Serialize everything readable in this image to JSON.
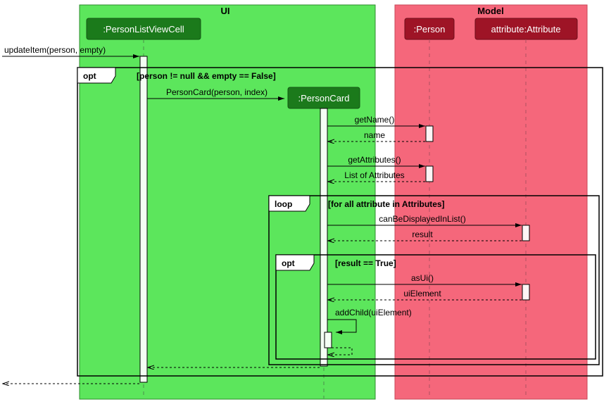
{
  "boxes": {
    "ui": {
      "label": "UI",
      "color": "#5CE65C"
    },
    "model": {
      "label": "Model",
      "color": "#F5677B"
    }
  },
  "participants": {
    "personListViewCell": ":PersonListViewCell",
    "personCard": ":PersonCard",
    "person": ":Person",
    "attribute": "attribute:Attribute"
  },
  "messages": {
    "updateItem": "updateItem(person, empty)",
    "personCardCtor": "PersonCard(person, index)",
    "getName": "getName()",
    "nameRet": "name",
    "getAttributes": "getAttributes()",
    "attributesRet": "List of Attributes",
    "canBeDisplayed": "canBeDisplayedInList()",
    "resultRet": "result",
    "asUi": "asUi()",
    "uiElementRet": "uiElement",
    "addChild": "addChild(uiElement)"
  },
  "fragments": {
    "opt1": {
      "type": "opt",
      "guard": "[person != null && empty == False]"
    },
    "loop": {
      "type": "loop",
      "guard": "[for all attribute in Attributes]"
    },
    "opt2": {
      "type": "opt",
      "guard": "[result == True]"
    }
  },
  "colors": {
    "headFill": "#1B7A1B",
    "headStroke": "#135613",
    "modelHeadFill": "#9E1426",
    "modelHeadStroke": "#6E0E1B",
    "lifeline": "#808080",
    "actFillUI": "#F4FEF4",
    "actFillModel": "#FEF4F5"
  }
}
